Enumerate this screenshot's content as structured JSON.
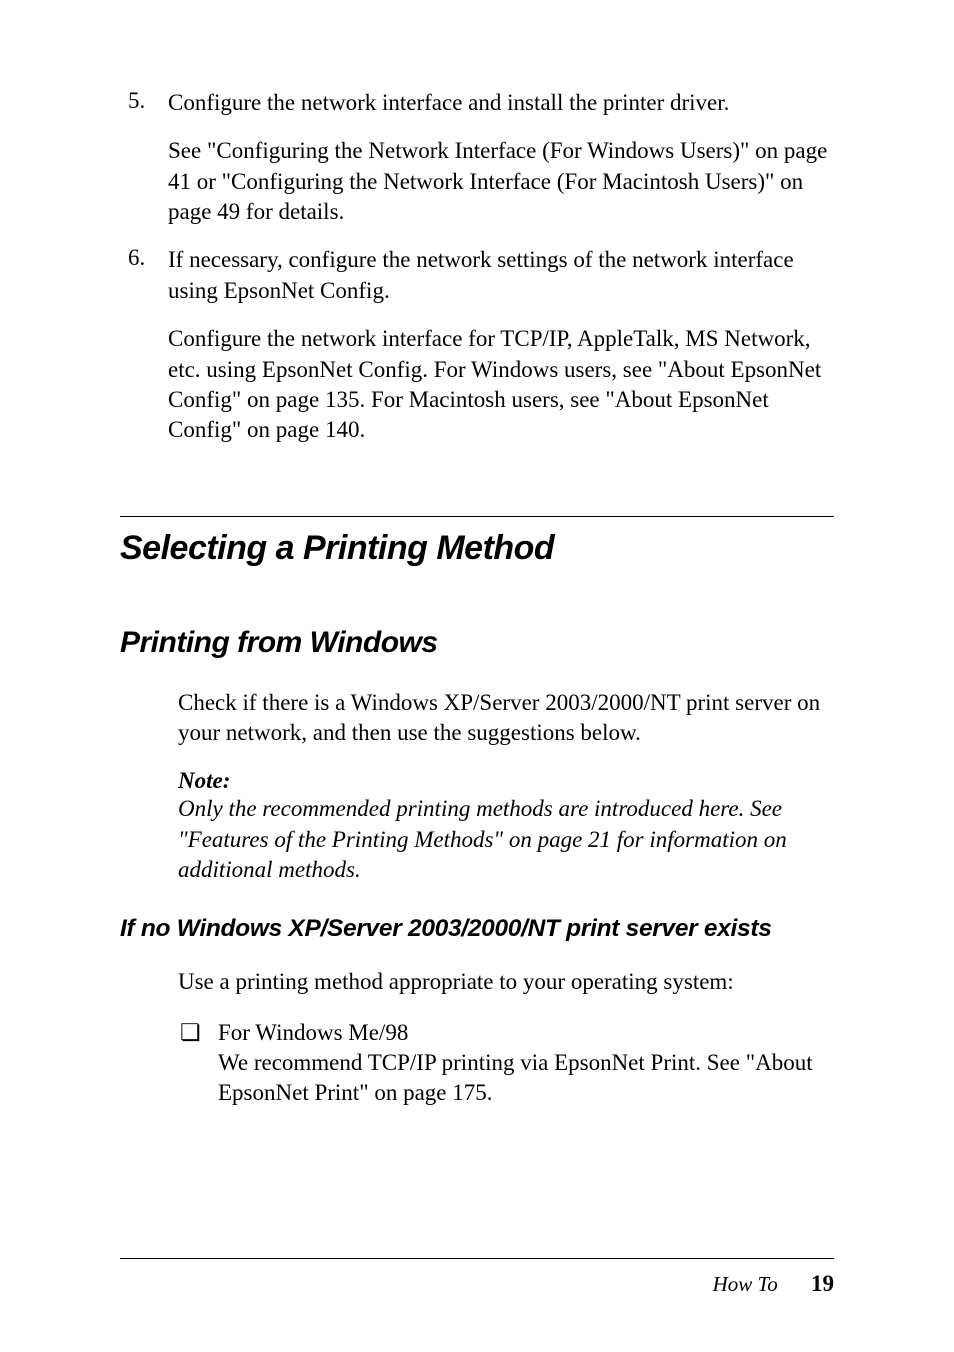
{
  "steps": [
    {
      "num": "5.",
      "lead": "Configure the network interface and install the printer driver.",
      "detail": "See  \"Configuring the Network Interface (For Windows Users)\" on page 41 or  \"Configuring the Network Interface (For Macintosh Users)\" on page 49 for details."
    },
    {
      "num": "6.",
      "lead": "If necessary, configure the network settings of the network interface using EpsonNet Config.",
      "detail": "Configure the network interface for TCP/IP, AppleTalk, MS Network, etc. using EpsonNet Config. For Windows users, see  \"About EpsonNet Config\" on page 135. For Macintosh users, see  \"About EpsonNet Config\" on page 140."
    }
  ],
  "section": {
    "heading": "Selecting a Printing Method"
  },
  "subsection": {
    "heading": "Printing from Windows",
    "body": "Check if there is a Windows XP/Server 2003/2000/NT print server on your network, and then use the suggestions below.",
    "note_label": "Note:",
    "note_text": "Only the recommended printing methods are introduced here. See  \"Features of the Printing Methods\" on page 21 for information on additional methods."
  },
  "minor": {
    "heading": "If no Windows XP/Server 2003/2000/NT print server exists",
    "body": "Use a printing method appropriate to your operating system:",
    "bullet": {
      "marker": "❏",
      "line1": "For Windows Me/98",
      "line2": "We recommend TCP/IP printing via EpsonNet Print. See \"About EpsonNet Print\" on page 175."
    }
  },
  "footer": {
    "title": "How To",
    "page": "19"
  }
}
